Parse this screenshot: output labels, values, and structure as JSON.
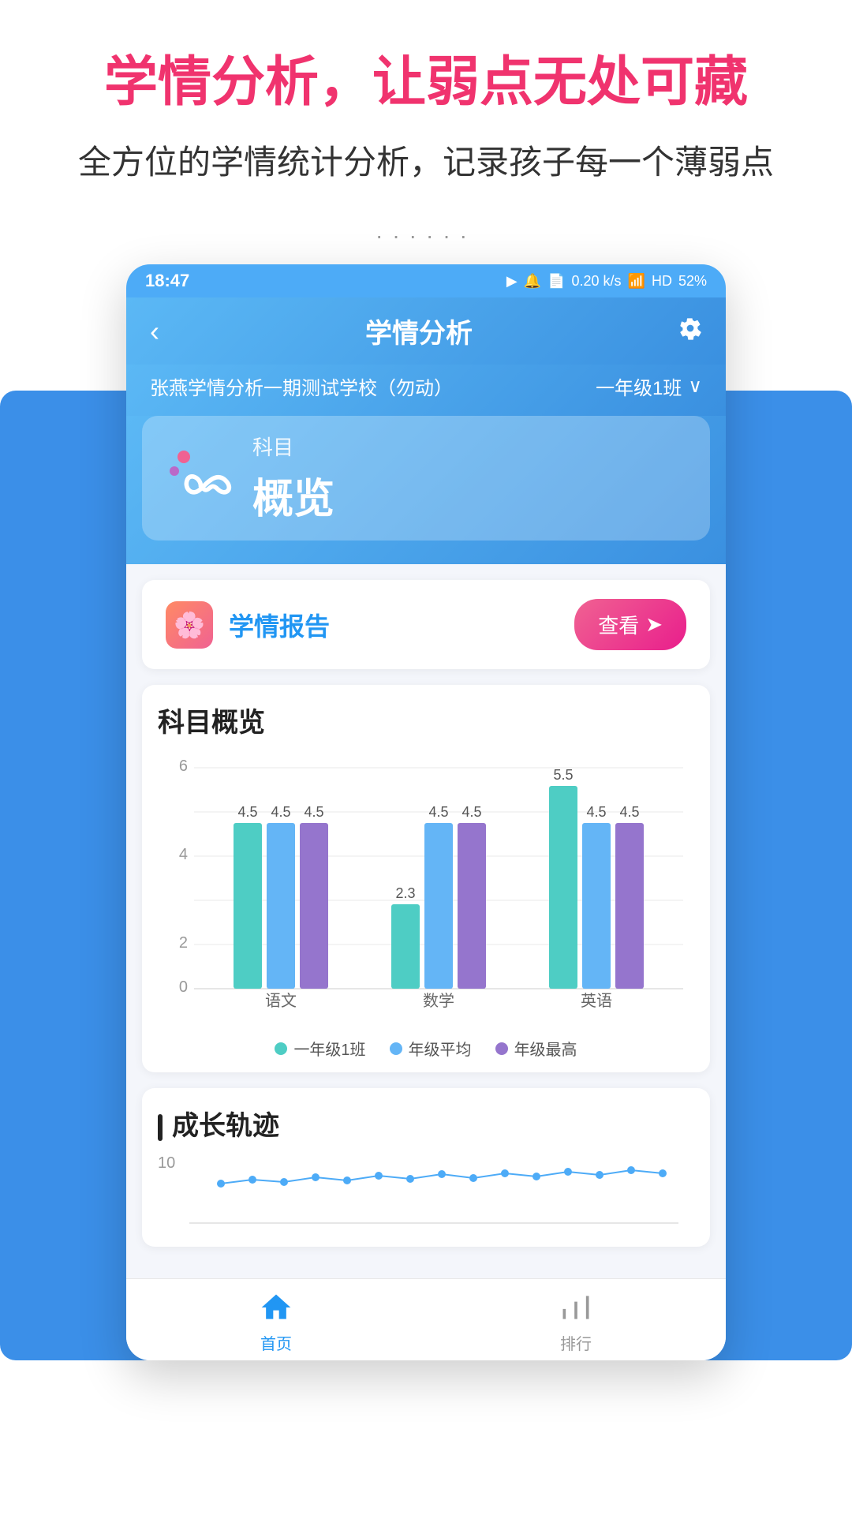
{
  "page": {
    "headline": "学情分析，让弱点无处可藏",
    "subtitle": "全方位的学情统计分析，记录孩子每一个薄弱点",
    "dots": "······"
  },
  "status_bar": {
    "time": "18:47",
    "network": "0.20 k/s",
    "battery": "52%"
  },
  "nav": {
    "back_label": "‹",
    "title": "学情分析",
    "settings_label": "⚙"
  },
  "school_info": {
    "name": "张燕学情分析一期测试学校（勿动）",
    "class": "一年级1班",
    "dropdown": "∨"
  },
  "subject_tab": {
    "label": "科目",
    "overview": "概览"
  },
  "report": {
    "label": "学情报告",
    "view_btn": "查看",
    "view_icon": "➤"
  },
  "chart": {
    "title": "科目概览",
    "y_labels": [
      "0",
      "2",
      "4",
      "6"
    ],
    "groups": [
      {
        "label": "语文",
        "bars": [
          {
            "value": 4.5,
            "color": "green"
          },
          {
            "value": 4.5,
            "color": "blue"
          },
          {
            "value": 4.5,
            "color": "purple"
          }
        ]
      },
      {
        "label": "数学",
        "bars": [
          {
            "value": 2.3,
            "color": "green"
          },
          {
            "value": 4.5,
            "color": "blue"
          },
          {
            "value": 4.5,
            "color": "purple"
          }
        ]
      },
      {
        "label": "英语",
        "bars": [
          {
            "value": 5.5,
            "color": "green"
          },
          {
            "value": 4.5,
            "color": "blue"
          },
          {
            "value": 4.5,
            "color": "purple"
          }
        ]
      }
    ],
    "max_value": 6,
    "legend": [
      {
        "label": "一年级1班",
        "color": "#4ecdc4"
      },
      {
        "label": "年级平均",
        "color": "#64b5f6"
      },
      {
        "label": "年级最高",
        "color": "#9575cd"
      }
    ]
  },
  "growth": {
    "title": "成长轨迹",
    "y_max": "10"
  },
  "bottom_nav": {
    "items": [
      {
        "label": "首页",
        "active": true
      },
      {
        "label": "排行",
        "active": false
      }
    ]
  }
}
